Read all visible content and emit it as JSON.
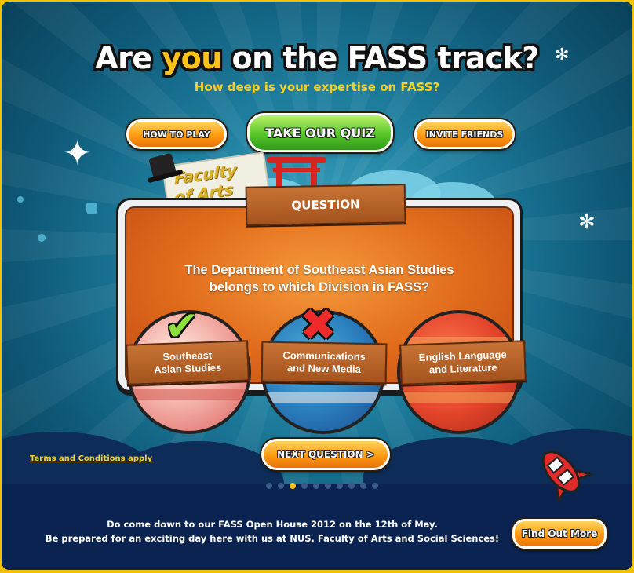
{
  "header": {
    "title_pre": "Are ",
    "title_highlight": "you",
    "title_post": " on the FASS track?",
    "subtitle": "How deep is your expertise on FASS?"
  },
  "nav": {
    "how_to_play": "HOW TO PLAY",
    "take_quiz": "TAKE OUR QUIZ",
    "invite_friends": "INVITE FRIENDS"
  },
  "decor": {
    "board_text": "Faculty of Arts"
  },
  "quiz": {
    "section_label": "QUESTION",
    "question_line1": "The Department of Southeast Asian Studies",
    "question_line2": "belongs to which Division in FASS?",
    "options": [
      {
        "line1": "Southeast",
        "line2": "Asian Studies",
        "status": "correct",
        "icon": "check-icon"
      },
      {
        "line1": "Communications",
        "line2": "and New Media",
        "status": "wrong",
        "icon": "cross-icon"
      },
      {
        "line1": "English Language",
        "line2": "and Literature",
        "status": "none",
        "icon": ""
      }
    ],
    "next_label": "NEXT QUESTION >",
    "progress": {
      "total": 10,
      "current": 3
    }
  },
  "footer": {
    "terms": "Terms and Conditions apply",
    "line1": "Do come down to our FASS Open House 2012 on the 12th of May.",
    "line2": "Be prepared for an exciting day here with us at NUS, Faculty of Arts and Social Sciences!",
    "find_out_more": "Find Out More"
  },
  "colors": {
    "accent_yellow": "#ffc21a",
    "button_orange": "#ff9a12",
    "button_green": "#57c62a",
    "panel_orange": "#e06a1b",
    "frame": "#f2c200"
  }
}
